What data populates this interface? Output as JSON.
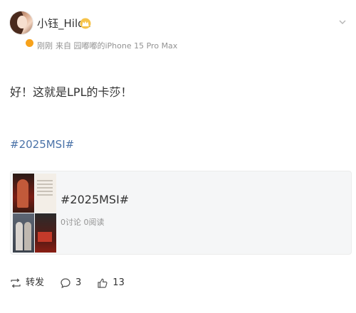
{
  "post": {
    "author": {
      "name": "小钰_Hilda",
      "avatar_icon": "avatar-photo",
      "verified_badge_icon": "verified-badge-icon",
      "member_icon": "crown-icon"
    },
    "time": "刚刚",
    "source": "来自 园嘟嘟的iPhone 15 Pro Max",
    "text": "好！这就是LPL的卡莎！",
    "hashtag": "#2025MSI#",
    "more_icon": "chevron-down-icon"
  },
  "topic_card": {
    "title": "#2025MSI#",
    "stats": "0讨论 0阅读"
  },
  "actions": {
    "repost_label": "转发",
    "comment_count": "3",
    "like_count": "13"
  },
  "colors": {
    "link": "#4a72a8",
    "text": "#333333",
    "meta": "#939393",
    "card_bg": "#f5f6f7",
    "badge": "#f7a21b"
  }
}
